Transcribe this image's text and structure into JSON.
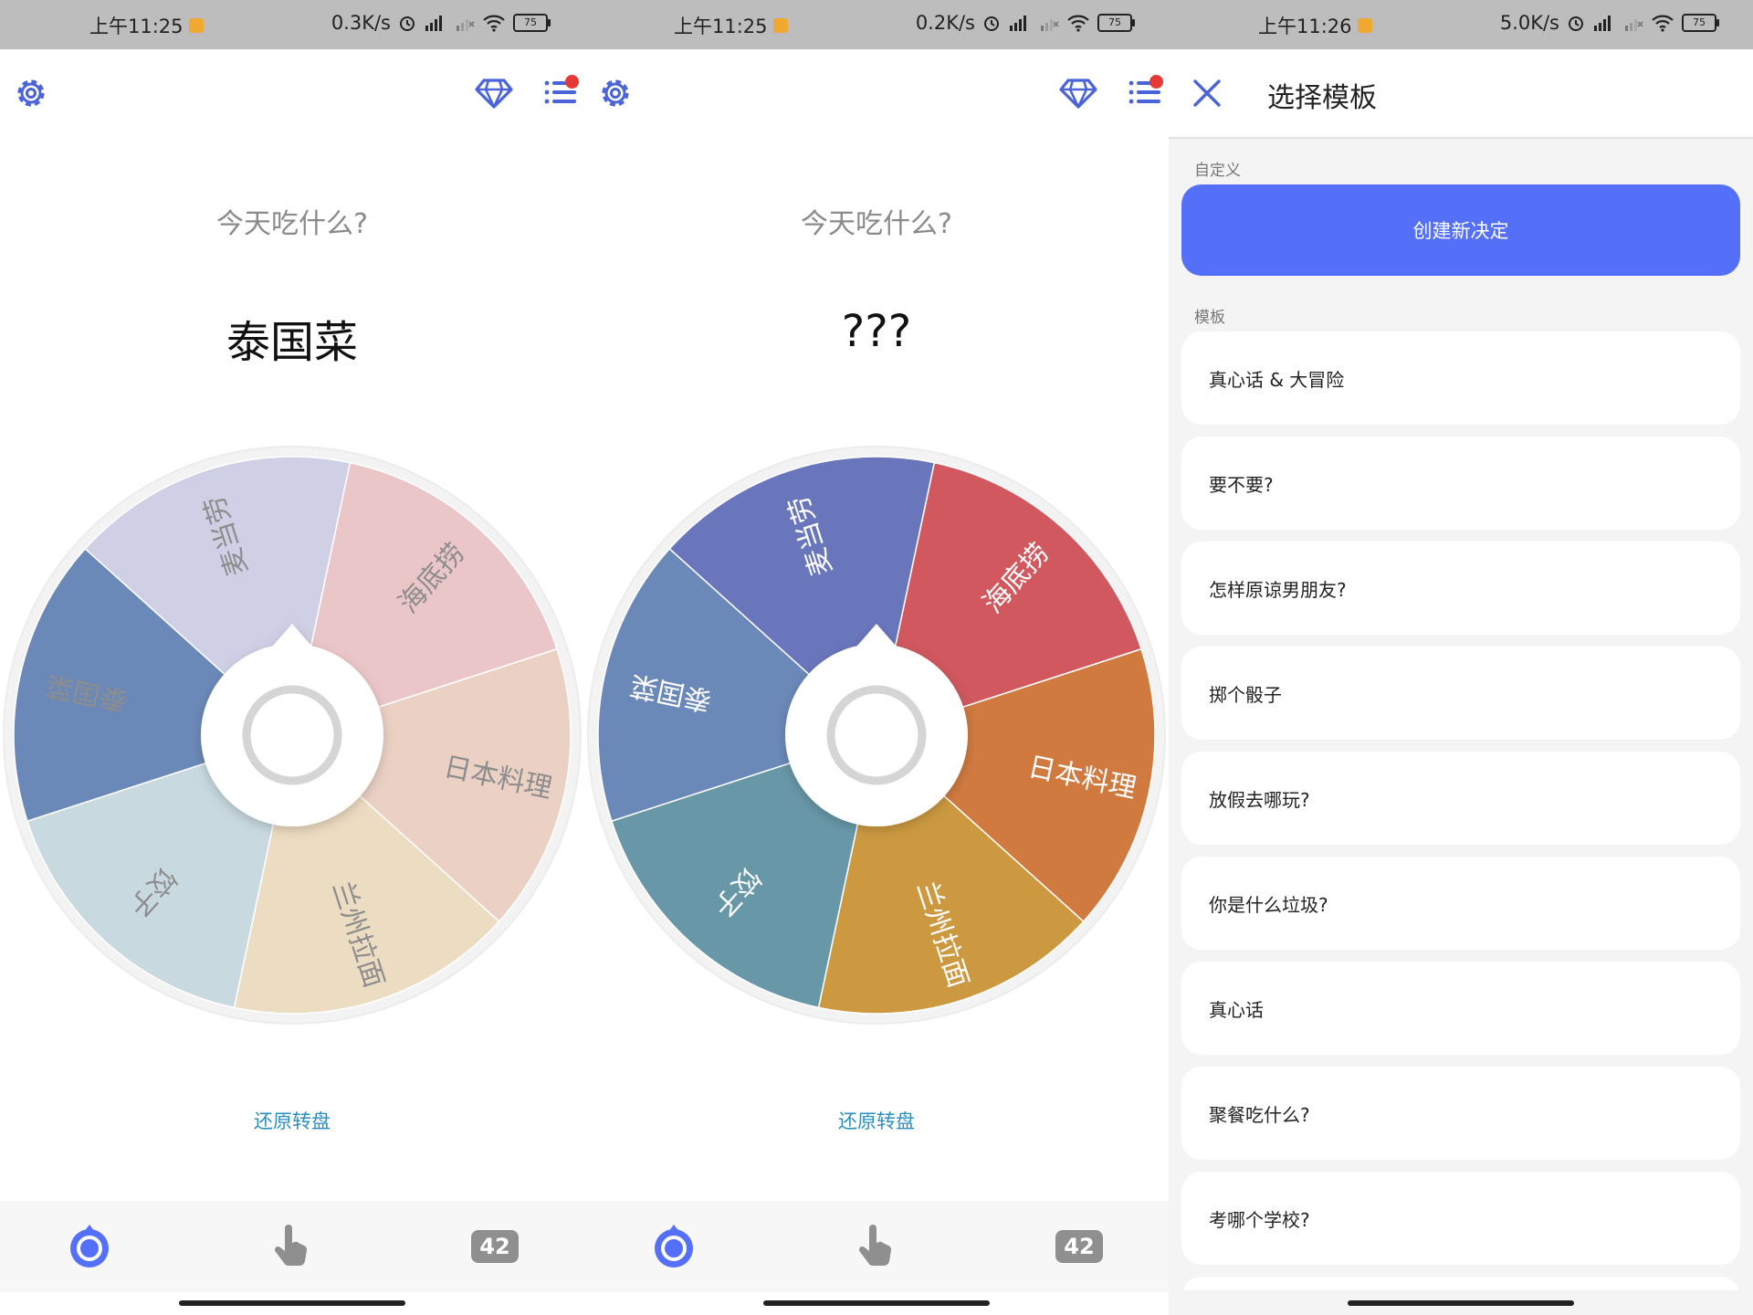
{
  "status": {
    "screens": [
      {
        "time": "上午11:25",
        "speed": "0.3K/s",
        "battery": "75"
      },
      {
        "time": "上午11:25",
        "speed": "0.2K/s",
        "battery": "75"
      },
      {
        "time": "上午11:26",
        "speed": "5.0K/s",
        "battery": "75"
      }
    ]
  },
  "wheel_screens": [
    {
      "question": "今天吃什么?",
      "result": "泰国菜",
      "restore_label": "还原转盘",
      "nav_count": "42"
    },
    {
      "question": "今天吃什么?",
      "result": "???",
      "restore_label": "还原转盘",
      "nav_count": "42"
    }
  ],
  "wheel": {
    "segments": [
      {
        "label": "泰国菜",
        "pale_color": "#6b89b8",
        "vivid_color": "#6b89b8"
      },
      {
        "label": "麦当劳",
        "pale_color": "#cfd0e6",
        "vivid_color": "#6a76bc"
      },
      {
        "label": "海底捞",
        "pale_color": "#ebc6c8",
        "vivid_color": "#d0585e"
      },
      {
        "label": "日本料理",
        "pale_color": "#ebd1c4",
        "vivid_color": "#d07a40"
      },
      {
        "label": "兰州拉面",
        "pale_color": "#ecdcc2",
        "vivid_color": "#cc9940"
      },
      {
        "label": "饺子",
        "pale_color": "#c9d9e0",
        "vivid_color": "#6898a8"
      }
    ]
  },
  "colors": {
    "accent": "#5570f8",
    "icon": "#4a63d8",
    "link": "#2b8fbf",
    "badge_red": "#e53935"
  },
  "icons": {
    "settings": "gear-icon",
    "premium": "diamond-icon",
    "decision_list": "list-icon",
    "close": "close-icon",
    "wheel_tab": "wheel-icon",
    "tap_tab": "hand-icon"
  },
  "templates": {
    "title": "选择模板",
    "custom_section": "自定义",
    "create_label": "创建新决定",
    "template_section": "模板",
    "items": [
      "真心话 & 大冒险",
      "要不要?",
      "怎样原谅男朋友?",
      "掷个骰子",
      "放假去哪玩?",
      "你是什么垃圾?",
      "真心话",
      "聚餐吃什么?",
      "考哪个学校?",
      ""
    ]
  }
}
